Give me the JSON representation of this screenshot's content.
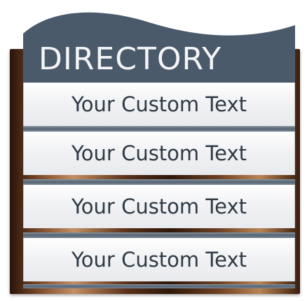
{
  "sign": {
    "title": "DIRECTORY",
    "rows": [
      {
        "label": "Your Custom Text"
      },
      {
        "label": "Your Custom Text"
      },
      {
        "label": "Your Custom Text"
      },
      {
        "label": "Your Custom Text"
      }
    ]
  },
  "colors": {
    "header": "#4b5a6b",
    "divider": "#5f6c7b",
    "text": "#2f3a45",
    "bronze": "#7a4a2a"
  }
}
